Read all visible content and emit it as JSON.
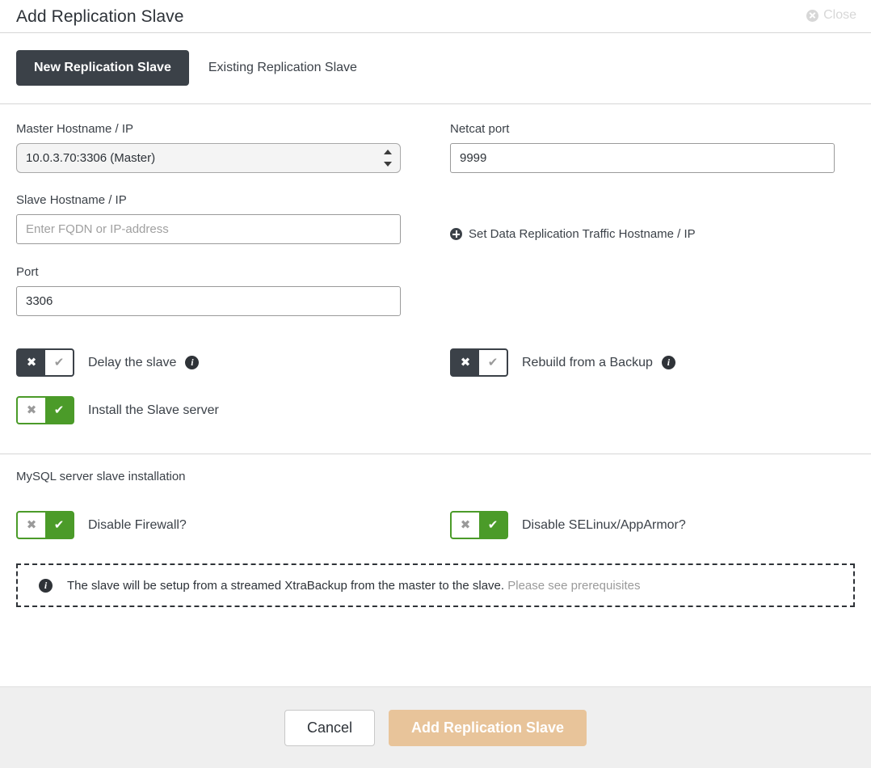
{
  "header": {
    "title": "Add Replication Slave",
    "close_label": "Close",
    "close_icon": "close-circle-icon"
  },
  "tabs": [
    {
      "label": "New Replication Slave",
      "active": true
    },
    {
      "label": "Existing Replication Slave",
      "active": false
    }
  ],
  "form": {
    "master_host": {
      "label": "Master Hostname / IP",
      "value": "10.0.3.70:3306 (Master)"
    },
    "netcat_port": {
      "label": "Netcat port",
      "value": "9999"
    },
    "slave_host": {
      "label": "Slave Hostname / IP",
      "value": "",
      "placeholder": "Enter FQDN or IP-address"
    },
    "set_traffic_host_link": {
      "label": "Set Data Replication Traffic Hostname / IP",
      "icon": "plus-circle-icon"
    },
    "port": {
      "label": "Port",
      "value": "3306"
    }
  },
  "toggles": {
    "delay_slave": {
      "label": "Delay the slave",
      "state": "off",
      "has_info": true
    },
    "rebuild_backup": {
      "label": "Rebuild from a Backup",
      "state": "off",
      "has_info": true
    },
    "install_slave": {
      "label": "Install the Slave server",
      "state": "on",
      "has_info": false
    },
    "disable_firewall": {
      "label": "Disable Firewall?",
      "state": "on",
      "has_info": false
    },
    "disable_selinux": {
      "label": "Disable SELinux/AppArmor?",
      "state": "on",
      "has_info": false
    }
  },
  "glyphs": {
    "cross": "✖",
    "check": "✔",
    "info": "i"
  },
  "section": {
    "title": "MySQL server slave installation"
  },
  "alert": {
    "icon": "info-circle-icon",
    "text": "The slave will be setup from a streamed XtraBackup from the master to the slave.",
    "link": "Please see prerequisites"
  },
  "footer": {
    "cancel_label": "Cancel",
    "submit_label": "Add Replication Slave"
  },
  "colors": {
    "toggle_on": "#4b9b29",
    "toggle_off": "#3b4148",
    "tab_active_bg": "#3b4148",
    "primary_button_bg": "#e8c49a",
    "footer_bg": "#efefef",
    "divider": "#d6d6d6"
  }
}
